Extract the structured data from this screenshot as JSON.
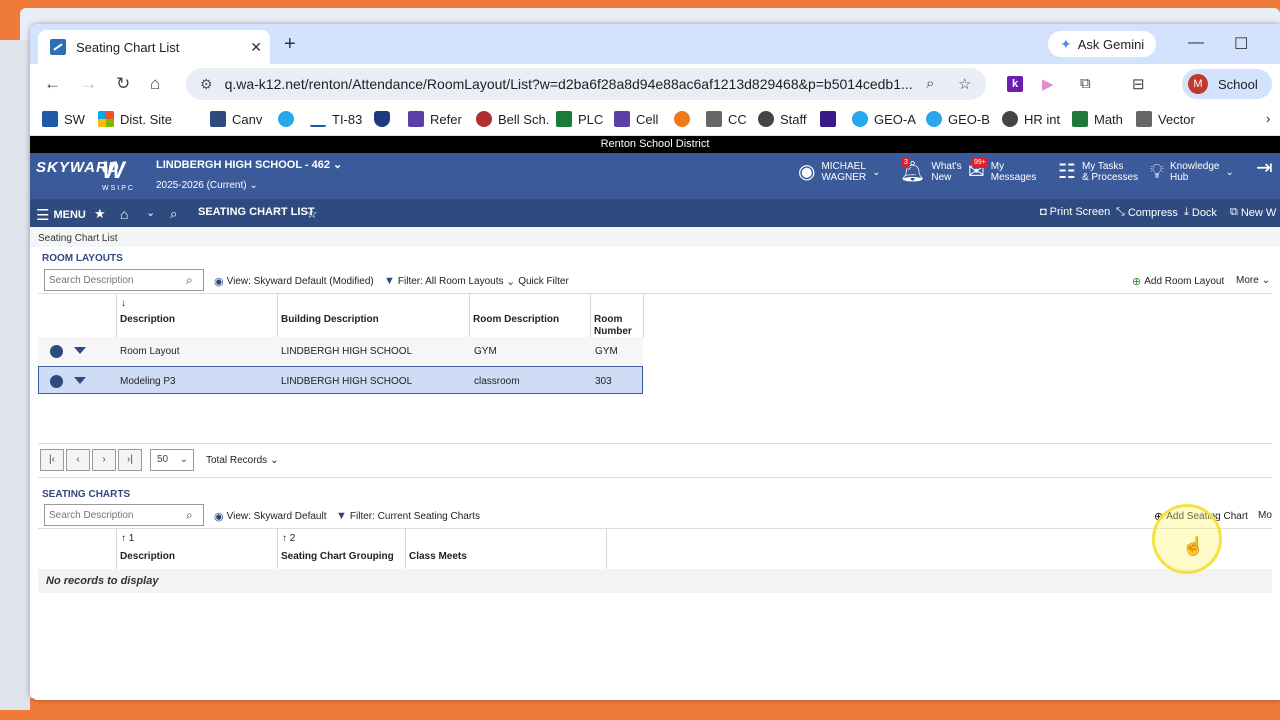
{
  "browser": {
    "tab_title": "Seating Chart List",
    "gemini_label": "Ask Gemini",
    "url": "q.wa-k12.net/renton/Attendance/RoomLayout/List?w=d2ba6f28a8d94e88ac6af1213d829468&p=b5014cedb1...",
    "profile_initial": "M",
    "profile_label": "School",
    "bookmarks": [
      "SW",
      "Dist. Site",
      "Canv",
      "TI-83",
      "Refer",
      "Bell Sch.",
      "PLC",
      "Cell",
      "CC",
      "Staff",
      "GEO-A",
      "GEO-B",
      "HR int",
      "Math",
      "Vector"
    ]
  },
  "skyward": {
    "district": "Renton School District",
    "logo_text": "SKYWARD",
    "logo_w": "W",
    "logo_sub": "WSIPC",
    "school": "LINDBERGH HIGH SCHOOL - 462",
    "year": "2025-2026 (Current)",
    "user_first": "MICHAEL",
    "user_last": "WAGNER",
    "whats_new_1": "What's",
    "whats_new_2": "New",
    "whats_new_badge": "3",
    "messages_1": "My",
    "messages_2": "Messages",
    "messages_badge": "99+",
    "tasks_1": "My Tasks",
    "tasks_2": "& Processes",
    "hub_1": "Knowledge",
    "hub_2": "Hub",
    "menu_label": "MENU",
    "page_title": "SEATING CHART LIST",
    "print_screen": "Print Screen",
    "compress": "Compress",
    "dock": "Dock",
    "new_window": "New W",
    "breadcrumb": "Seating Chart List"
  },
  "room_layouts": {
    "section": "ROOM LAYOUTS",
    "search_placeholder": "Search Description",
    "view": "View: Skyward Default (Modified)",
    "filter": "Filter: All Room Layouts",
    "quick_filter": "Quick Filter",
    "add": "Add Room Layout",
    "more": "More",
    "col_description": "Description",
    "col_building": "Building Description",
    "col_room": "Room Description",
    "col_number_1": "Room",
    "col_number_2": "Number",
    "rows": [
      {
        "description": "Room Layout",
        "building": "LINDBERGH HIGH SCHOOL",
        "room": "GYM",
        "number": "GYM"
      },
      {
        "description": "Modeling P3",
        "building": "LINDBERGH HIGH SCHOOL",
        "room": "classroom",
        "number": "303"
      }
    ],
    "page_size": "50",
    "total_records": "Total Records"
  },
  "seating_charts": {
    "section": "SEATING CHARTS",
    "search_placeholder": "Search Description",
    "view": "View: Skyward Default",
    "filter": "Filter: Current Seating Charts",
    "add": "Add Seating Chart",
    "more": "Mo",
    "sort_1": "1",
    "sort_2": "2",
    "col_description": "Description",
    "col_grouping": "Seating Chart Grouping",
    "col_class_meets": "Class Meets",
    "empty": "No records to display"
  }
}
